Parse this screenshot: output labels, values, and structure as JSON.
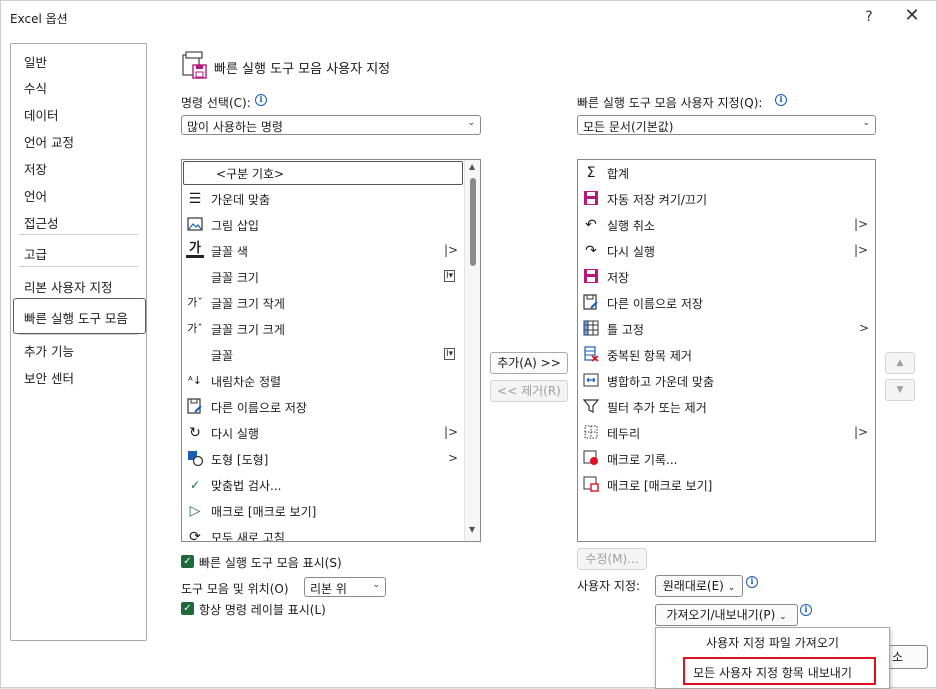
{
  "window": {
    "title": "Excel 옵션",
    "help": "?",
    "close": "✕"
  },
  "nav": {
    "items": [
      {
        "label": "일반"
      },
      {
        "label": "수식"
      },
      {
        "label": "데이터"
      },
      {
        "label": "언어 교정"
      },
      {
        "label": "저장"
      },
      {
        "label": "언어"
      },
      {
        "label": "접근성"
      },
      {
        "label": "고급"
      },
      {
        "label": "리본 사용자 지정"
      },
      {
        "label": "빠른 실행 도구 모음"
      },
      {
        "label": "추가 기능"
      },
      {
        "label": "보안 센터"
      }
    ],
    "selected": "빠른 실행 도구 모음"
  },
  "header": {
    "title": "빠른 실행 도구 모음 사용자 지정",
    "icon": "quick-access-toolbar-icon"
  },
  "left": {
    "choose_label": "명령 선택(C):",
    "choose_value": "많이 사용하는 명령",
    "commands": [
      {
        "label": "<구분 기호>",
        "icon": "",
        "sub": ""
      },
      {
        "label": "가운데 맞춤",
        "icon": "align-center-icon",
        "sub": ""
      },
      {
        "label": "그림 삽입",
        "icon": "insert-picture-icon",
        "sub": ""
      },
      {
        "label": "글꼴 색",
        "icon": "font-color-icon",
        "sub": "|>"
      },
      {
        "label": "글꼴 크기",
        "icon": "",
        "sub": "I▾"
      },
      {
        "label": "글꼴 크기 작게",
        "icon": "decrease-font-icon",
        "sub": ""
      },
      {
        "label": "글꼴 크기 크게",
        "icon": "increase-font-icon",
        "sub": ""
      },
      {
        "label": "글꼴",
        "icon": "",
        "sub": "I▾"
      },
      {
        "label": "내림차순 정렬",
        "icon": "sort-descending-icon",
        "sub": ""
      },
      {
        "label": "다른 이름으로 저장",
        "icon": "save-as-icon",
        "sub": ""
      },
      {
        "label": "다시 실행",
        "icon": "redo-icon",
        "sub": "|>"
      },
      {
        "label": "도형 [도형]",
        "icon": "shapes-icon",
        "sub": ">"
      },
      {
        "label": "맞춤법 검사...",
        "icon": "spelling-icon",
        "sub": ""
      },
      {
        "label": "매크로 [매크로 보기]",
        "icon": "macro-play-icon",
        "sub": ""
      },
      {
        "label": "모두 새로 고침",
        "icon": "refresh-all-icon",
        "sub": ""
      }
    ],
    "show_toolbar_label": "빠른 실행 도구 모음 표시(S)",
    "position_label": "도구 모음 및 위치(O)",
    "position_value": "리본 위",
    "show_labels_label": "항상 명령 레이블 표시(L)"
  },
  "right": {
    "customize_label": "빠른 실행 도구 모음 사용자 지정(Q):",
    "customize_value": "모든 문서(기본값)",
    "items": [
      {
        "label": "합계",
        "icon": "sum-icon",
        "sub": ""
      },
      {
        "label": "자동 저장 켜기/끄기",
        "icon": "autosave-icon",
        "sub": ""
      },
      {
        "label": "실행 취소",
        "icon": "undo-icon",
        "sub": "|>"
      },
      {
        "label": "다시 실행",
        "icon": "redo-icon",
        "sub": "|>"
      },
      {
        "label": "저장",
        "icon": "save-icon",
        "sub": ""
      },
      {
        "label": "다른 이름으로 저장",
        "icon": "save-as-icon",
        "sub": ""
      },
      {
        "label": "틀 고정",
        "icon": "freeze-panes-icon",
        "sub": ">"
      },
      {
        "label": "중복된 항목 제거",
        "icon": "remove-duplicates-icon",
        "sub": ""
      },
      {
        "label": "병합하고 가운데 맞춤",
        "icon": "merge-center-icon",
        "sub": ""
      },
      {
        "label": "필터 추가 또는 제거",
        "icon": "filter-icon",
        "sub": ""
      },
      {
        "label": "테두리",
        "icon": "borders-icon",
        "sub": "|>"
      },
      {
        "label": "매크로 기록...",
        "icon": "record-macro-icon",
        "sub": ""
      },
      {
        "label": "매크로 [매크로 보기]",
        "icon": "view-macros-icon",
        "sub": ""
      }
    ],
    "modify_label": "수정(M)...",
    "user_customize_label": "사용자 지정:",
    "reset_label": "원래대로(E)",
    "import_export_label": "가져오기/내보내기(P)"
  },
  "middle": {
    "add_label": "추가(A) >>",
    "remove_label": "<< 제거(R)"
  },
  "import_menu": {
    "items": [
      "사용자 지정 파일 가져오기",
      "모든 사용자 지정 항목 내보내기"
    ],
    "highlighted": 1
  },
  "footer": {
    "cancel_partial": "소"
  },
  "colors": {
    "checkbox": "#1d6b3d",
    "highlight": "#e0101c",
    "info": "#1a5fb4",
    "save_icon": "#b5177a"
  }
}
